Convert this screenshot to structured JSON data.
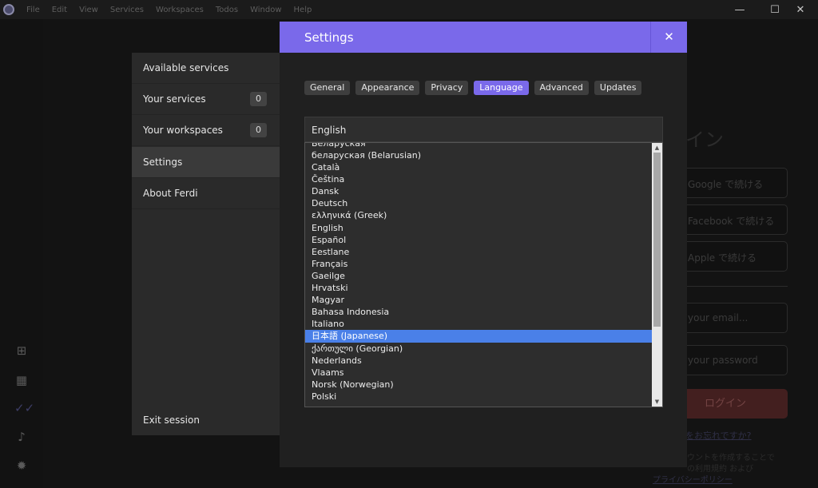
{
  "titlebar": {
    "menu": [
      "File",
      "Edit",
      "View",
      "Services",
      "Workspaces",
      "Todos",
      "Window",
      "Help"
    ],
    "minimize_icon": "minimize-icon",
    "maximize_icon": "maximize-icon",
    "close_icon": "close-icon"
  },
  "rail": {
    "icons": [
      "plus-icon",
      "grid-icon",
      "checkmarks-icon",
      "bell-icon",
      "gear-icon"
    ]
  },
  "background_login": {
    "title": "イン",
    "fields": [
      "Google で続ける",
      "Facebook で続ける",
      "Apple で続ける"
    ],
    "email_placeholder": "your email...",
    "password_placeholder": "your password",
    "login_button": "ログイン",
    "forgot_link": "をお忘れですか?",
    "terms_line1": "ウントを作成することで",
    "terms_line2": "の利用規約 および",
    "privacy_link": "プライバシーポリシー"
  },
  "sidebar": {
    "items": [
      {
        "label": "Available services"
      },
      {
        "label": "Your services",
        "badge": "0"
      },
      {
        "label": "Your workspaces",
        "badge": "0"
      },
      {
        "label": "Settings"
      },
      {
        "label": "About Ferdi"
      }
    ],
    "exit_label": "Exit session"
  },
  "dialog": {
    "title": "Settings",
    "close_label": "✕",
    "tabs": [
      "General",
      "Appearance",
      "Privacy",
      "Language",
      "Advanced",
      "Updates"
    ],
    "active_tab": "Language",
    "select_value": "English",
    "options": [
      "Беларуская",
      "беларуская (Belarusian)",
      "Català",
      "Čeština",
      "Dansk",
      "Deutsch",
      "ελληνικά (Greek)",
      "English",
      "Español",
      "Eestlane",
      "Français",
      "Gaeilge",
      "Hrvatski",
      "Magyar",
      "Bahasa Indonesia",
      "Italiano",
      "日本語 (Japanese)",
      "ქართული (Georgian)",
      "Nederlands",
      "Vlaams",
      "Norsk (Norwegian)",
      "Polski"
    ],
    "selected_option": "日本語 (Japanese)"
  },
  "colors": {
    "accent": "#7a69ea",
    "selection": "#4a80e8"
  }
}
